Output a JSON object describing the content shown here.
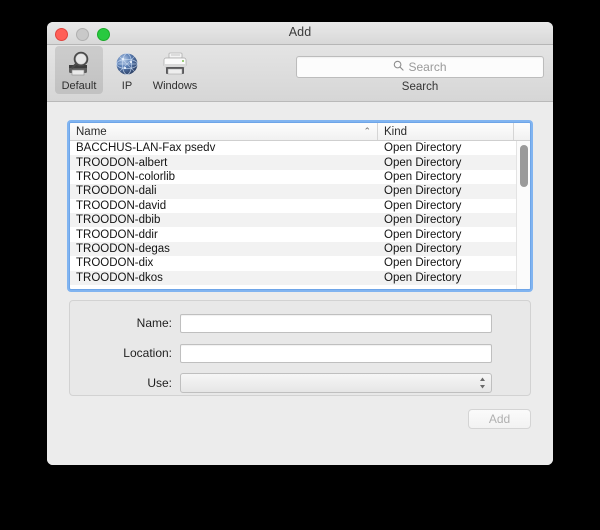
{
  "window": {
    "title": "Add",
    "traffic_lights": [
      {
        "name": "close",
        "color": "#ff5f57"
      },
      {
        "name": "minimize",
        "color": "#c9c9c9"
      },
      {
        "name": "zoom",
        "color": "#28c940"
      }
    ]
  },
  "toolbar": {
    "tabs": [
      {
        "label": "Default",
        "icon": "printer-magnifier-icon",
        "selected": true
      },
      {
        "label": "IP",
        "icon": "globe-icon",
        "selected": false
      },
      {
        "label": "Windows",
        "icon": "printer-icon",
        "selected": false
      }
    ],
    "search": {
      "placeholder": "Search",
      "value": "",
      "icon": "search-icon",
      "caption": "Search"
    }
  },
  "list": {
    "columns": [
      {
        "key": "name",
        "label": "Name",
        "sort": "ascending",
        "sort_glyph": "⌃"
      },
      {
        "key": "kind",
        "label": "Kind",
        "sort": "none"
      }
    ],
    "rows": [
      {
        "name": "BACCHUS-LAN-Fax psedv",
        "kind": "Open Directory"
      },
      {
        "name": "TROODON-albert",
        "kind": "Open Directory"
      },
      {
        "name": "TROODON-colorlib",
        "kind": "Open Directory"
      },
      {
        "name": "TROODON-dali",
        "kind": "Open Directory"
      },
      {
        "name": "TROODON-david",
        "kind": "Open Directory"
      },
      {
        "name": "TROODON-dbib",
        "kind": "Open Directory"
      },
      {
        "name": "TROODON-ddir",
        "kind": "Open Directory"
      },
      {
        "name": "TROODON-degas",
        "kind": "Open Directory"
      },
      {
        "name": "TROODON-dix",
        "kind": "Open Directory"
      },
      {
        "name": "TROODON-dkos",
        "kind": "Open Directory"
      }
    ],
    "scrollbar": {
      "visible": true,
      "thumb_position": "top"
    },
    "focused": true,
    "focus_ring_color": "#81b4f0"
  },
  "form": {
    "fields": [
      {
        "label": "Name:",
        "value": "",
        "placeholder": "",
        "type": "text"
      },
      {
        "label": "Location:",
        "value": "",
        "placeholder": "",
        "type": "text"
      },
      {
        "label": "Use:",
        "value": "",
        "placeholder": "",
        "type": "popup"
      }
    ]
  },
  "actions": {
    "add_label": "Add",
    "add_enabled": false
  }
}
